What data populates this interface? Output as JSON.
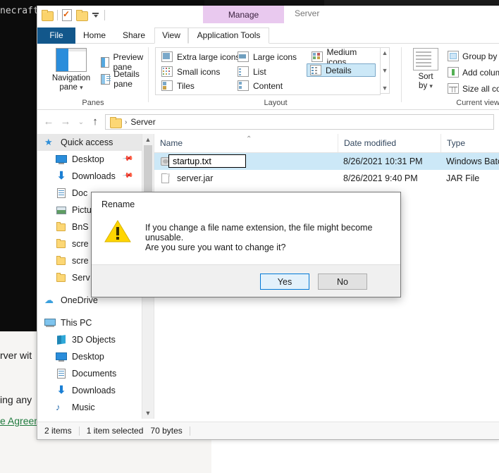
{
  "background": {
    "console_text": "necraft",
    "page_lines": [
      "rver wit",
      "ing any"
    ],
    "page_link": "e Agreem"
  },
  "window": {
    "context_tab": "Manage",
    "title": "Server",
    "quick_access": [
      {
        "name": "folder-icon"
      },
      {
        "name": "properties-icon"
      },
      {
        "name": "new-folder-icon"
      },
      {
        "name": "customize-qat-caret-icon"
      }
    ]
  },
  "ribbon": {
    "tabs": [
      {
        "label": "File",
        "id": "file"
      },
      {
        "label": "Home",
        "id": "home"
      },
      {
        "label": "Share",
        "id": "share"
      },
      {
        "label": "View",
        "id": "view"
      },
      {
        "label": "Application Tools",
        "id": "apptools"
      }
    ],
    "active_tab": "View",
    "groups": {
      "panes": {
        "label": "Panes",
        "navigation_pane": "Navigation\npane",
        "navigation_pane_line1": "Navigation",
        "navigation_pane_line2": "pane",
        "preview_pane": "Preview pane",
        "details_pane": "Details pane"
      },
      "layout": {
        "label": "Layout",
        "items": [
          {
            "label": "Extra large icons",
            "selected": false
          },
          {
            "label": "Large icons",
            "selected": false
          },
          {
            "label": "Medium icons",
            "selected": false
          },
          {
            "label": "Small icons",
            "selected": false
          },
          {
            "label": "List",
            "selected": false
          },
          {
            "label": "Details",
            "selected": true
          },
          {
            "label": "Tiles",
            "selected": false
          },
          {
            "label": "Content",
            "selected": false
          }
        ]
      },
      "current_view": {
        "label": "Current view",
        "sort_by_line1": "Sort",
        "sort_by_line2": "by",
        "group_by": "Group by",
        "add_columns": "Add column",
        "size_all_columns": "Size all colu"
      }
    }
  },
  "address_bar": {
    "path_text": "Server",
    "separator": "›",
    "back": "←",
    "forward": "→",
    "recent": "⌄",
    "up": "↑"
  },
  "nav_tree": {
    "items": [
      {
        "label": "Quick access",
        "icon": "quick-access-star-icon",
        "level": "root",
        "selected": true,
        "pinned": false
      },
      {
        "label": "Desktop",
        "icon": "desktop-icon",
        "level": "child",
        "pinned": true
      },
      {
        "label": "Downloads",
        "icon": "downloads-icon",
        "level": "child",
        "pinned": true
      },
      {
        "label": "Doc",
        "icon": "documents-icon",
        "level": "child",
        "pinned": false
      },
      {
        "label": "Pictu",
        "icon": "pictures-icon",
        "level": "child",
        "pinned": false
      },
      {
        "label": "BnS",
        "icon": "folder-icon",
        "level": "child",
        "pinned": false
      },
      {
        "label": "scre",
        "icon": "folder-icon",
        "level": "child",
        "pinned": false
      },
      {
        "label": "scre",
        "icon": "folder-icon",
        "level": "child",
        "pinned": false
      },
      {
        "label": "Serv",
        "icon": "folder-icon",
        "level": "child",
        "pinned": false
      },
      {
        "label": "OneDrive",
        "icon": "onedrive-cloud-icon",
        "level": "root",
        "pinned": false
      },
      {
        "label": "This PC",
        "icon": "this-pc-icon",
        "level": "root",
        "pinned": false
      },
      {
        "label": "3D Objects",
        "icon": "3d-objects-icon",
        "level": "child",
        "pinned": false
      },
      {
        "label": "Desktop",
        "icon": "desktop-icon",
        "level": "child",
        "pinned": false
      },
      {
        "label": "Documents",
        "icon": "documents-icon",
        "level": "child",
        "pinned": false
      },
      {
        "label": "Downloads",
        "icon": "downloads-icon",
        "level": "child",
        "pinned": false
      },
      {
        "label": "Music",
        "icon": "music-icon",
        "level": "child",
        "pinned": false
      }
    ]
  },
  "file_list": {
    "columns": [
      {
        "label": "Name",
        "sorted": true,
        "sort_direction": "asc"
      },
      {
        "label": "Date modified",
        "sorted": false
      },
      {
        "label": "Type",
        "sorted": false
      }
    ],
    "sort_mark": "⌃",
    "rows": [
      {
        "name": "startup.txt",
        "date_modified": "8/26/2021 10:31 PM",
        "type": "Windows Batc",
        "icon": "batch-file-icon",
        "selected": true,
        "renaming": true
      },
      {
        "name": "server.jar",
        "date_modified": "8/26/2021 9:40 PM",
        "type": "JAR File",
        "icon": "jar-file-icon",
        "selected": false,
        "renaming": false
      }
    ],
    "rename_value": "startup.txt"
  },
  "status_bar": {
    "item_count": "2 items",
    "selection": "1 item selected",
    "size": "70 bytes"
  },
  "dialog": {
    "title": "Rename",
    "icon": "warning-triangle-icon",
    "message_line1": "If you change a file name extension, the file might become unusable.",
    "message_line2": "Are you sure you want to change it?",
    "buttons": [
      {
        "label": "Yes",
        "default": true
      },
      {
        "label": "No",
        "default": false
      }
    ]
  },
  "colors": {
    "selection_blue": "#cce8f7",
    "file_tab_blue": "#12578b",
    "context_tab_purple": "#e9c9ef",
    "default_button_border": "#0078d7",
    "warning_yellow": "#ffd500",
    "link_green": "#1f7a3d"
  }
}
